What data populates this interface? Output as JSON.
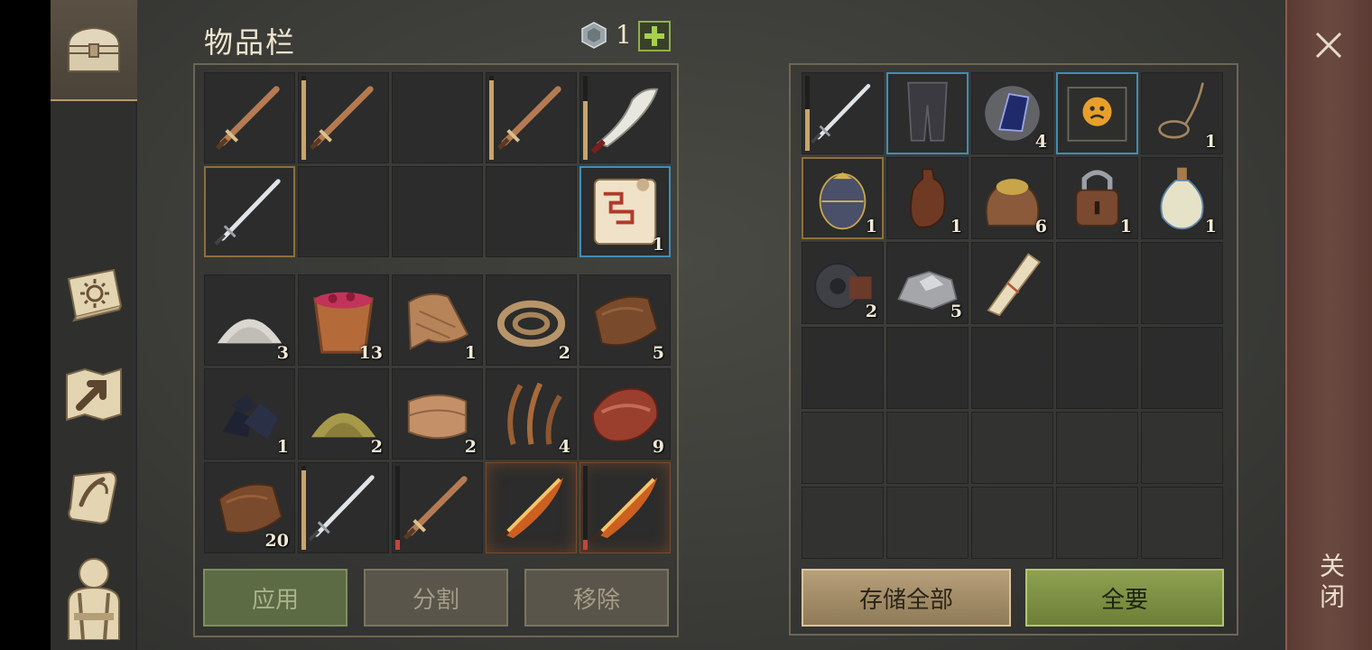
{
  "inventory": {
    "title": "物品栏",
    "currency_count": "1",
    "plus_symbol": "+",
    "equip_rows": [
      [
        {
          "icon": "bronze-sword-icon",
          "count": "",
          "durability": null
        },
        {
          "icon": "bronze-sword-icon",
          "count": "",
          "durability": 0.95,
          "dur_color": "#c9a46b"
        },
        {
          "icon": "",
          "count": ""
        },
        {
          "icon": "bronze-sword-icon",
          "count": "",
          "durability": 0.95,
          "dur_color": "#c9a46b"
        },
        {
          "icon": "scimitar-icon",
          "count": "",
          "durability": 0.7,
          "dur_color": "#c9a46b"
        }
      ],
      [
        {
          "icon": "steel-sword-icon",
          "count": "",
          "selected": "gold"
        },
        {
          "icon": "",
          "count": ""
        },
        {
          "icon": "",
          "count": ""
        },
        {
          "icon": "",
          "count": ""
        },
        {
          "icon": "treasure-map-scroll-icon",
          "count": "1",
          "selected": "blue"
        }
      ]
    ],
    "item_rows": [
      [
        {
          "icon": "salt-pile-icon",
          "count": "3"
        },
        {
          "icon": "berry-bucket-icon",
          "count": "13"
        },
        {
          "icon": "cloth-rag-icon",
          "count": "1"
        },
        {
          "icon": "rope-coil-icon",
          "count": "2"
        },
        {
          "icon": "leather-icon",
          "count": "5"
        }
      ],
      [
        {
          "icon": "coal-icon",
          "count": "1"
        },
        {
          "icon": "sulfur-pile-icon",
          "count": "2"
        },
        {
          "icon": "fabric-roll-icon",
          "count": "2"
        },
        {
          "icon": "fiber-icon",
          "count": "4"
        },
        {
          "icon": "raw-meat-icon",
          "count": "9"
        }
      ],
      [
        {
          "icon": "leather-icon",
          "count": "20"
        },
        {
          "icon": "steel-sword-icon",
          "count": "",
          "durability": 0.95,
          "dur_color": "#c9a46b"
        },
        {
          "icon": "bronze-sword-icon",
          "count": "",
          "durability": 0.12,
          "dur_color": "#c4443c"
        },
        {
          "icon": "flaming-sword-icon",
          "count": "",
          "glow": true
        },
        {
          "icon": "flaming-sword-icon",
          "count": "",
          "glow": true,
          "durability": 0.12,
          "dur_color": "#c4443c"
        }
      ]
    ],
    "buttons": {
      "apply": "应用",
      "split": "分割",
      "remove": "移除"
    }
  },
  "storage": {
    "rows": [
      [
        {
          "icon": "steel-sword-icon",
          "count": "",
          "durability": 0.55,
          "dur_color": "#c9a46b"
        },
        {
          "icon": "chain-leggings-icon",
          "count": "",
          "selected": "blue"
        },
        {
          "icon": "crystal-shard-icon",
          "count": "4"
        },
        {
          "icon": "cursed-book-icon",
          "count": "",
          "selected": "blue"
        },
        {
          "icon": "rope-lasso-icon",
          "count": "1"
        }
      ],
      [
        {
          "icon": "egg-icon",
          "count": "1",
          "selected": "gold"
        },
        {
          "icon": "clay-bottle-icon",
          "count": "1"
        },
        {
          "icon": "grain-sack-icon",
          "count": "6"
        },
        {
          "icon": "padlock-icon",
          "count": "1"
        },
        {
          "icon": "potion-flask-icon",
          "count": "1"
        }
      ],
      [
        {
          "icon": "iron-gear-icon",
          "count": "2"
        },
        {
          "icon": "stone-ore-icon",
          "count": "5"
        },
        {
          "icon": "parchment-roll-icon",
          "count": ""
        },
        {
          "icon": "",
          "count": ""
        },
        {
          "icon": "",
          "count": ""
        }
      ],
      [
        {
          "icon": "",
          "count": ""
        },
        {
          "icon": "",
          "count": ""
        },
        {
          "icon": "",
          "count": ""
        },
        {
          "icon": "",
          "count": ""
        },
        {
          "icon": "",
          "count": ""
        }
      ],
      [
        {
          "icon": "",
          "count": "",
          "locked": true
        },
        {
          "icon": "",
          "count": "",
          "locked": true
        },
        {
          "icon": "",
          "count": "",
          "locked": true
        },
        {
          "icon": "",
          "count": "",
          "locked": true
        },
        {
          "icon": "",
          "count": "",
          "locked": true
        }
      ],
      [
        {
          "icon": "",
          "count": "",
          "locked": true
        },
        {
          "icon": "",
          "count": "",
          "locked": true
        },
        {
          "icon": "",
          "count": "",
          "locked": true
        },
        {
          "icon": "",
          "count": "",
          "locked": true
        },
        {
          "icon": "",
          "count": "",
          "locked": true
        }
      ]
    ],
    "buttons": {
      "store_all": "存储全部",
      "take_all": "全要"
    }
  },
  "sidebar": {
    "tabs": [
      "chest-icon",
      "sun-book-icon",
      "map-arrow-icon",
      "quest-scroll-icon",
      "character-icon"
    ]
  },
  "close": {
    "label": "关闭",
    "icon": "close-icon"
  },
  "colors": {
    "accent_green": "#8ea150",
    "accent_tan": "#b7a07a",
    "selected_blue": "#3e8fb6",
    "selected_gold": "#8d6f3c"
  }
}
